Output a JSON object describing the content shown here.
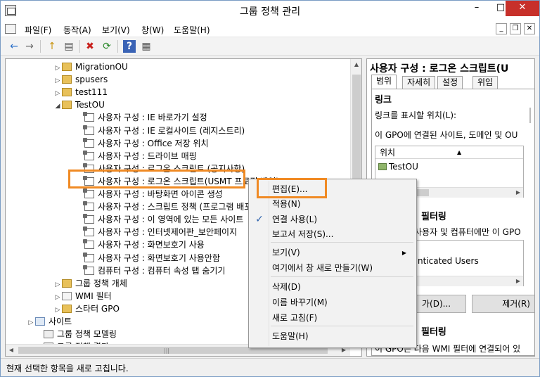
{
  "window": {
    "title": "그룹 정책 관리",
    "min_glyph": "–",
    "max_glyph": "□",
    "close_glyph": "✕"
  },
  "menubar": {
    "items": [
      "파일(F)",
      "동작(A)",
      "보기(V)",
      "창(W)",
      "도움말(H)"
    ],
    "mdi_min": "_",
    "mdi_restore": "❐",
    "mdi_close": "✕"
  },
  "toolbar": {
    "back": "←",
    "forward": "→",
    "up": "↑",
    "show": "▤",
    "delete": "✖",
    "refresh": "⟳",
    "help": "?",
    "props": "▦"
  },
  "tree": {
    "items": [
      {
        "label": "MigrationOU",
        "exp": "▷",
        "icon": "folder"
      },
      {
        "label": "spusers",
        "exp": "▷",
        "icon": "folder"
      },
      {
        "label": "test111",
        "exp": "▷",
        "icon": "folder"
      },
      {
        "label": "TestOU",
        "exp": "◢",
        "icon": "folder"
      },
      {
        "label": "사용자 구성 : IE  바로가기 설정",
        "exp": "",
        "icon": "script"
      },
      {
        "label": "사용자 구성 : IE 로컬사이트 (레지스트리)",
        "exp": "",
        "icon": "script"
      },
      {
        "label": "사용자 구성 : Office 저장 위치",
        "exp": "",
        "icon": "script"
      },
      {
        "label": "사용자 구성 : 드라이브 매핑",
        "exp": "",
        "icon": "script"
      },
      {
        "label": "사용자 구성 : 로그온 스크립트 (공지사항)",
        "exp": "",
        "icon": "script"
      },
      {
        "label": "사용자 구성 : 로그온 스크립트(USMT 프로필 백업)",
        "exp": "",
        "icon": "script"
      },
      {
        "label": "사용자 구성 : 바탕화면 아이콘 생성",
        "exp": "",
        "icon": "script"
      },
      {
        "label": "사용자 구성 : 스크립트 정책 (프로그램 배포)",
        "exp": "",
        "icon": "script"
      },
      {
        "label": "사용자 구성 : 이 영역에 있는 모든 사이트",
        "exp": "",
        "icon": "script"
      },
      {
        "label": "사용자 구성 : 인터넷제어판_보안페이지",
        "exp": "",
        "icon": "script"
      },
      {
        "label": "사용자 구성 : 화면보호기 사용",
        "exp": "",
        "icon": "script"
      },
      {
        "label": "사용자 구성 : 화면보호기 사용안함",
        "exp": "",
        "icon": "script"
      },
      {
        "label": "컴퓨터 구성 : 컴퓨터 속성 탭 숨기기",
        "exp": "",
        "icon": "script"
      },
      {
        "label": "그룹 정책 개체",
        "exp": "▷",
        "icon": "folder"
      },
      {
        "label": "WMI 필터",
        "exp": "▷",
        "icon": "filter"
      },
      {
        "label": "스타터 GPO",
        "exp": "▷",
        "icon": "folder"
      },
      {
        "label": "사이트",
        "exp": "▷",
        "icon": "site"
      },
      {
        "label": "그룹 정책 모델링",
        "exp": "",
        "icon": "model"
      },
      {
        "label": "그룹 정책 결과",
        "exp": "",
        "icon": "model"
      }
    ]
  },
  "right": {
    "header": "사용자 구성 : 로그온 스크립트(U",
    "tabs": [
      "범위",
      "자세히",
      "설정",
      "위임"
    ],
    "link_section": "링크",
    "link_label": "링크를 표시할 위치(L):",
    "link_desc": "이 GPO에 연결된 사이트, 도메인 및 OU",
    "list_header": "위치",
    "list_item": "TestOU",
    "filter_section": "필터링",
    "filter_desc": "사용자 및 컴퓨터에만 이 GPO",
    "auth_users": "nticated Users",
    "add_btn": "가(D)...",
    "remove_btn": "제거(R)",
    "wmi_section": "필터링",
    "wmi_desc": "이 GPO는 다음 WMI 필터에 연결되어 있"
  },
  "context_menu": {
    "items": [
      {
        "label": "편집(E)...",
        "checked": false,
        "submenu": false
      },
      {
        "label": "적용(N)",
        "checked": false,
        "submenu": false
      },
      {
        "label": "연결 사용(L)",
        "checked": true,
        "submenu": false
      },
      {
        "label": "보고서 저장(S)...",
        "checked": false,
        "submenu": false
      },
      {
        "label": "보기(V)",
        "checked": false,
        "submenu": true
      },
      {
        "label": "여기에서 창 새로 만들기(W)",
        "checked": false,
        "submenu": false
      },
      {
        "label": "삭제(D)",
        "checked": false,
        "submenu": false
      },
      {
        "label": "이름 바꾸기(M)",
        "checked": false,
        "submenu": false
      },
      {
        "label": "새로 고침(F)",
        "checked": false,
        "submenu": false
      },
      {
        "label": "도움말(H)",
        "checked": false,
        "submenu": false
      }
    ],
    "check_glyph": "✓",
    "submenu_glyph": "▶"
  },
  "status": {
    "text": "현재 선택한 항목을 새로 고칩니다."
  },
  "colors": {
    "highlight": "#f08a24",
    "close_button": "#c7302a",
    "check": "#2d62ad"
  }
}
